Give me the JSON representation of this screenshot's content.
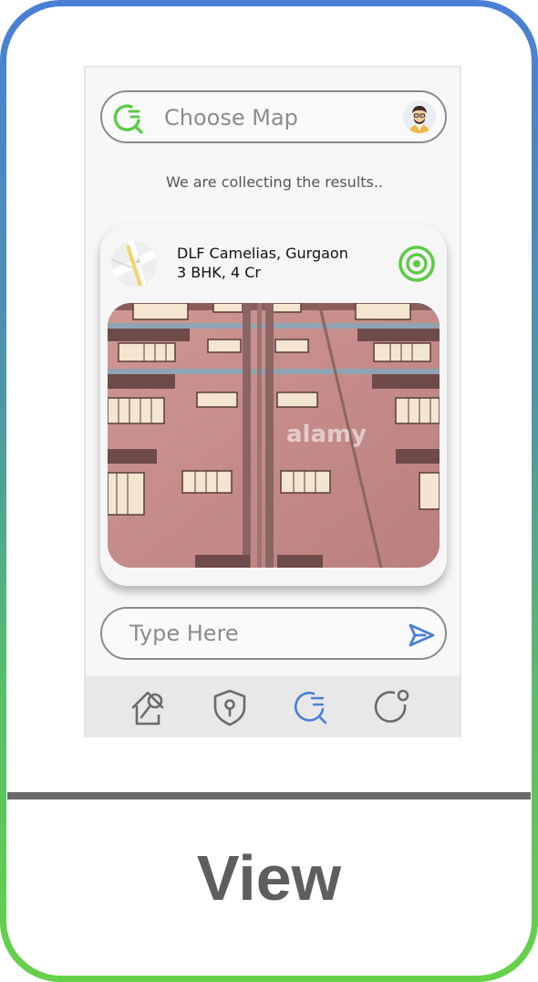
{
  "search": {
    "placeholder": "Choose Map"
  },
  "status": {
    "text": "We are collecting the results.."
  },
  "result_card": {
    "title": "DLF Camelias, Gurgaon",
    "subtitle": "3 BHK, 4 Cr",
    "photo_watermark": "alamy"
  },
  "message_input": {
    "placeholder": "Type Here"
  },
  "bottom_nav": {
    "items": [
      {
        "icon": "house-search-icon",
        "active": false
      },
      {
        "icon": "shield-key-icon",
        "active": false
      },
      {
        "icon": "search-refresh-icon",
        "active": true
      },
      {
        "icon": "profile-circle-icon",
        "active": false
      }
    ]
  },
  "footer": {
    "label": "View"
  },
  "colors": {
    "accent_green": "#5ccb45",
    "accent_blue": "#4a7fd6",
    "border_gradient_top": "#4a7fd6",
    "border_gradient_bottom": "#66d14a",
    "nav_background": "#e8e8e8"
  }
}
